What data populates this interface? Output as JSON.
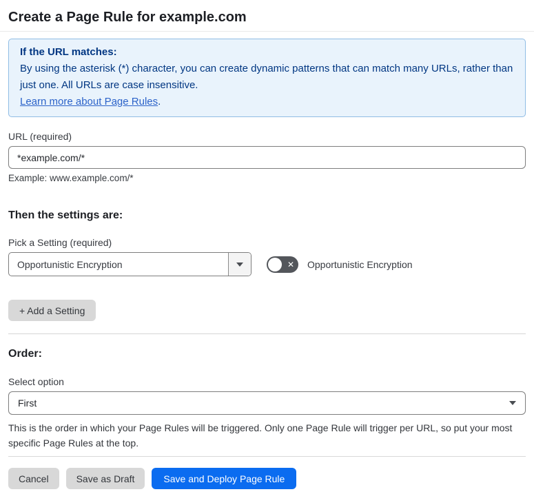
{
  "page": {
    "title": "Create a Page Rule for example.com"
  },
  "info_box": {
    "heading": "If the URL matches:",
    "body": "By using the asterisk (*) character, you can create dynamic patterns that can match many URLs, rather than just one. All URLs are case insensitive.",
    "link": "Learn more about Page Rules",
    "link_suffix": "."
  },
  "url_field": {
    "label": "URL (required)",
    "value": "*example.com/*",
    "example": "Example: www.example.com/*"
  },
  "settings": {
    "heading": "Then the settings are:",
    "pick_label": "Pick a Setting (required)",
    "selected_setting": "Opportunistic Encryption",
    "toggle_label": "Opportunistic Encryption",
    "toggle_state": "off",
    "add_button_label": "+ Add a Setting"
  },
  "order": {
    "heading": "Order:",
    "label": "Select option",
    "selected_option": "First",
    "help": "This is the order in which your Page Rules will be triggered. Only one Page Rule will trigger per URL, so put your most specific Page Rules at the top."
  },
  "footer": {
    "cancel_label": "Cancel",
    "save_draft_label": "Save as Draft",
    "save_deploy_label": "Save and Deploy Page Rule"
  },
  "colors": {
    "accent_blue": "#0b6cf0",
    "info_bg": "#e9f3fc",
    "info_border": "#8fbce4",
    "info_text": "#003682",
    "link_blue": "#2b62c9"
  }
}
